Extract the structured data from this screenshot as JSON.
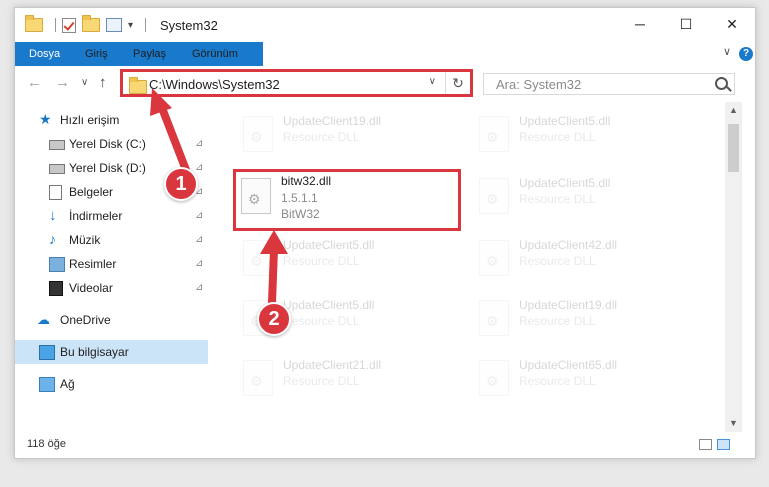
{
  "window": {
    "title": "System32",
    "controls": [
      "─",
      "☐",
      "✕"
    ]
  },
  "ribbon": {
    "tabs": [
      "Dosya",
      "Giriş",
      "Paylaş",
      "Görünüm"
    ],
    "help": "?",
    "collapse": "∨"
  },
  "nav": {
    "back": "←",
    "forward": "→",
    "recent": "∨",
    "up": "↑",
    "address": "C:\\Windows\\System32",
    "address_dropdown": "∨",
    "refresh": "↻",
    "search_placeholder": "Ara: System32"
  },
  "sidebar": {
    "items": [
      {
        "label": "Hızlı erişim",
        "icon": "star-icon",
        "pinned": false
      },
      {
        "label": "Yerel Disk (C:)",
        "icon": "drive-icon",
        "pinned": true
      },
      {
        "label": "Yerel Disk (D:)",
        "icon": "drive-icon",
        "pinned": true
      },
      {
        "label": "Belgeler",
        "icon": "documents-icon",
        "pinned": true
      },
      {
        "label": "İndirmeler",
        "icon": "download-icon",
        "pinned": true
      },
      {
        "label": "Müzik",
        "icon": "music-icon",
        "pinned": true
      },
      {
        "label": "Resimler",
        "icon": "pictures-icon",
        "pinned": true
      },
      {
        "label": "Videolar",
        "icon": "video-icon",
        "pinned": true
      },
      {
        "label": "OneDrive",
        "icon": "cloud-icon",
        "pinned": false
      },
      {
        "label": "Bu bilgisayar",
        "icon": "computer-icon",
        "pinned": false,
        "selected": true
      },
      {
        "label": "Ağ",
        "icon": "network-icon",
        "pinned": false
      }
    ],
    "pin_glyph": "📌"
  },
  "files": {
    "left": [
      {
        "name": "UpdateClient19.dll",
        "type": "Resource DLL"
      },
      {
        "name": "bitw32.dll",
        "version": "1.5.1.1",
        "company": "BitW32",
        "highlighted": true
      },
      {
        "name": "UpdateClient5.dll",
        "type": "Resource DLL"
      },
      {
        "name": "UpdateClient5.dll",
        "type": "Resource DLL"
      },
      {
        "name": "UpdateClient21.dll",
        "type": "Resource DLL"
      }
    ],
    "right": [
      {
        "name": "UpdateClient5.dll",
        "type": "Resource DLL"
      },
      {
        "name": "UpdateClient5.dll",
        "type": "Resource DLL"
      },
      {
        "name": "UpdateClient42.dll",
        "type": "Resource DLL"
      },
      {
        "name": "UpdateClient19.dll",
        "type": "Resource DLL"
      },
      {
        "name": "UpdateClient65.dll",
        "type": "Resource DLL"
      }
    ]
  },
  "status": {
    "count": "118 öğe"
  },
  "callouts": [
    "1",
    "2"
  ],
  "colors": {
    "accent": "#1979ca",
    "highlight_red": "#d9363e",
    "selected_bg": "#cce4f7"
  }
}
